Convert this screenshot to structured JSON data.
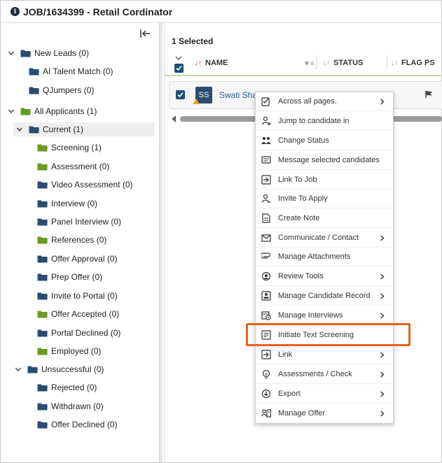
{
  "window": {
    "title": "JOB/1634399 - Retail Cordinator"
  },
  "tree": [
    {
      "label": "New Leads (0)",
      "level": 0,
      "expanded": true,
      "color": "#2b4c6f"
    },
    {
      "label": "AI Talent Match (0)",
      "level": 1,
      "color": "#2b4c6f"
    },
    {
      "label": "QJumpers (0)",
      "level": 1,
      "color": "#2b4c6f"
    },
    {
      "label": "All Applicants (1)",
      "level": 0,
      "expanded": true,
      "color": "#6a9a1f"
    },
    {
      "label": "Current (1)",
      "level": 1,
      "expanded": true,
      "selected": true,
      "color": "#2b4c6f"
    },
    {
      "label": "Screening (1)",
      "level": 2,
      "color": "#6a9a1f"
    },
    {
      "label": "Assessment (0)",
      "level": 2,
      "color": "#6a9a1f"
    },
    {
      "label": "Video Assessment (0)",
      "level": 2,
      "color": "#2b4c6f"
    },
    {
      "label": "Interview (0)",
      "level": 2,
      "color": "#2b4c6f"
    },
    {
      "label": "Panel Interview (0)",
      "level": 2,
      "color": "#2b4c6f"
    },
    {
      "label": "References (0)",
      "level": 2,
      "color": "#6a9a1f"
    },
    {
      "label": "Offer Approval (0)",
      "level": 2,
      "color": "#2b4c6f"
    },
    {
      "label": "Prep Offer (0)",
      "level": 2,
      "color": "#2b4c6f"
    },
    {
      "label": "Invite to Portal (0)",
      "level": 2,
      "color": "#2b4c6f"
    },
    {
      "label": "Offer Accepted (0)",
      "level": 2,
      "color": "#6a9a1f"
    },
    {
      "label": "Portal Declined (0)",
      "level": 2,
      "color": "#2b4c6f"
    },
    {
      "label": "Employed (0)",
      "level": 2,
      "color": "#6a9a1f"
    },
    {
      "label": "Unsuccessful (0)",
      "level": 1,
      "expanded": true,
      "color": "#2b4c6f"
    },
    {
      "label": "Rejected (0)",
      "level": 2,
      "color": "#2b4c6f"
    },
    {
      "label": "Withdrawn (0)",
      "level": 2,
      "color": "#2b4c6f"
    },
    {
      "label": "Offer Declined (0)",
      "level": 2,
      "color": "#2b4c6f"
    }
  ],
  "grid": {
    "selected_count": "1 Selected",
    "columns": {
      "name": "NAME",
      "status": "STATUS",
      "flag": "FLAG PS"
    },
    "row": {
      "initials": "SS",
      "name": "Swati Shar"
    }
  },
  "menu": [
    {
      "label": "Across all pages.",
      "icon": "checklist-icon",
      "submenu": true
    },
    {
      "label": "Jump to candidate in",
      "icon": "person-arrow-icon",
      "submenu": false
    },
    {
      "label": "Change Status",
      "icon": "people-icon",
      "submenu": false
    },
    {
      "label": "Message selected candidates",
      "icon": "message-icon",
      "submenu": false
    },
    {
      "label": "Link To Job",
      "icon": "link-in-icon",
      "submenu": false
    },
    {
      "label": "Invite To Apply",
      "icon": "person-invite-icon",
      "submenu": false
    },
    {
      "label": "Create Note",
      "icon": "note-icon",
      "submenu": false
    },
    {
      "label": "Communicate / Contact",
      "icon": "envelope-icon",
      "submenu": true
    },
    {
      "label": "Manage Attachments",
      "icon": "paperclip-icon",
      "submenu": false
    },
    {
      "label": "Review Tools",
      "icon": "review-icon",
      "submenu": true
    },
    {
      "label": "Manage Candidate Record",
      "icon": "record-icon",
      "submenu": true
    },
    {
      "label": "Manage Interviews",
      "icon": "calendar-clock-icon",
      "submenu": true
    },
    {
      "label": "Initiate Text Screening",
      "icon": "text-screening-icon",
      "submenu": false
    },
    {
      "label": "Link",
      "icon": "link-in-icon",
      "submenu": true
    },
    {
      "label": "Assessments / Check",
      "icon": "lightbulb-icon",
      "submenu": true
    },
    {
      "label": "Export",
      "icon": "export-icon",
      "submenu": true
    },
    {
      "label": "Manage Offer",
      "icon": "offer-icon",
      "submenu": true
    }
  ],
  "colors": {
    "accent": "#1f4e79",
    "highlight": "#e8601c",
    "folder_green": "#6a9a1f",
    "folder_navy": "#2b4c6f"
  }
}
